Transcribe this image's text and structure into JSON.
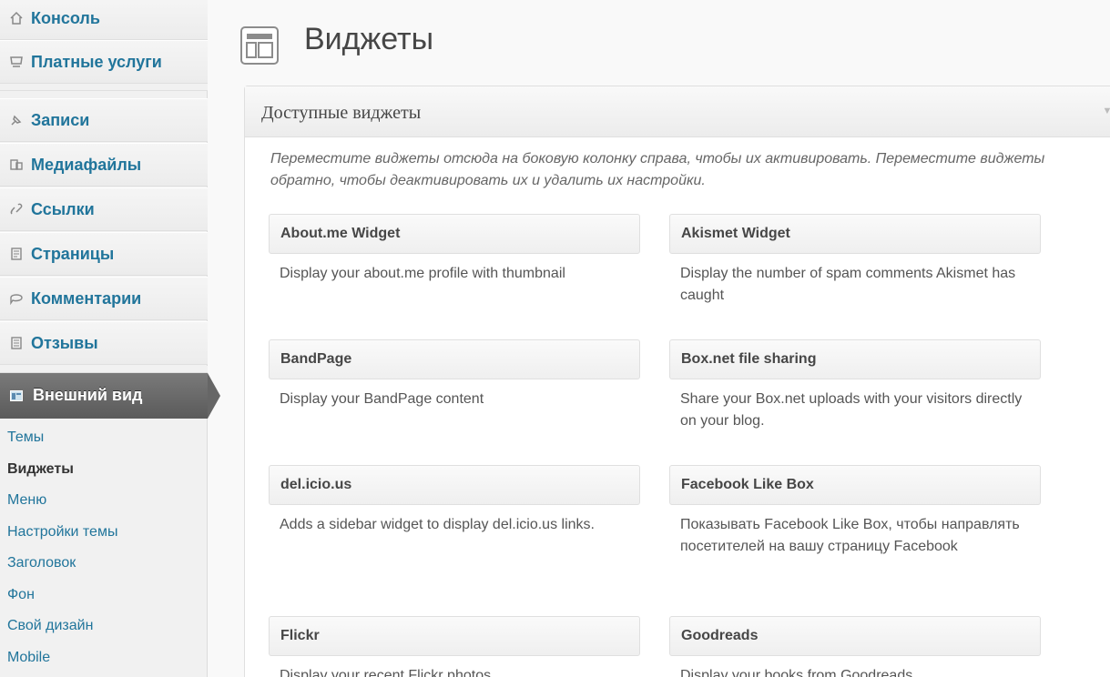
{
  "sidebar": {
    "items": [
      {
        "label": "Консоль",
        "icon": "dashboard-icon"
      },
      {
        "label": "Платные услуги",
        "icon": "store-icon"
      },
      {
        "label": "Записи",
        "icon": "posts-pin-icon"
      },
      {
        "label": "Медиафайлы",
        "icon": "media-icon"
      },
      {
        "label": "Ссылки",
        "icon": "links-icon"
      },
      {
        "label": "Страницы",
        "icon": "pages-icon"
      },
      {
        "label": "Комментарии",
        "icon": "comments-icon"
      },
      {
        "label": "Отзывы",
        "icon": "feedback-icon"
      }
    ],
    "active": {
      "label": "Внешний вид",
      "icon": "appearance-icon"
    },
    "submenu": [
      {
        "label": "Темы"
      },
      {
        "label": "Виджеты",
        "current": true
      },
      {
        "label": "Меню"
      },
      {
        "label": "Настройки темы"
      },
      {
        "label": "Заголовок"
      },
      {
        "label": "Фон"
      },
      {
        "label": "Свой дизайн"
      },
      {
        "label": "Mobile"
      }
    ]
  },
  "main": {
    "title": "Виджеты",
    "panel": {
      "title": "Доступные виджеты",
      "description": "Переместите виджеты отсюда на боковую колонку справа, чтобы их активировать. Переместите виджеты обратно, чтобы деактивировать их и удалить их настройки.",
      "widgets": [
        {
          "title": "About.me Widget",
          "desc": "Display your about.me profile with thumbnail"
        },
        {
          "title": "Akismet Widget",
          "desc": "Display the number of spam comments Akismet has caught"
        },
        {
          "title": "BandPage",
          "desc": "Display your BandPage content"
        },
        {
          "title": "Box.net file sharing",
          "desc": "Share your Box.net uploads with your visitors directly on your blog."
        },
        {
          "title": "del.icio.us",
          "desc": "Adds a sidebar widget to display del.icio.us links."
        },
        {
          "title": "Facebook Like Box",
          "desc": "Показывать Facebook Like Box, чтобы направлять посетителей на вашу страницу Facebook"
        },
        {
          "title": "Flickr",
          "desc": "Display your recent Flickr photos."
        },
        {
          "title": "Goodreads",
          "desc": "Display your books from Goodreads"
        }
      ]
    }
  },
  "colors": {
    "link": "#21759b",
    "active_menu": "#666666",
    "sidebar_bg": "#f1f1f1"
  }
}
